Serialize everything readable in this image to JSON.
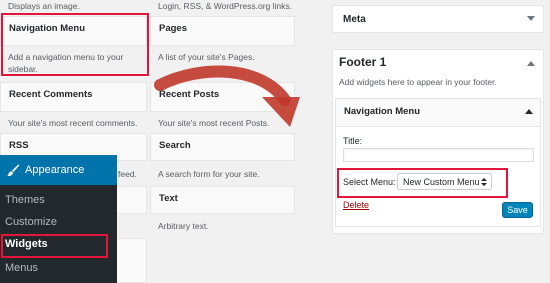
{
  "available_widgets": {
    "top_left_desc": "Displays an image.",
    "top_mid_desc": "Login, RSS, & WordPress.org links.",
    "navigation_menu": {
      "title": "Navigation Menu",
      "desc": "Add a navigation menu to your sidebar."
    },
    "pages": {
      "title": "Pages",
      "desc": "A list of your site's Pages."
    },
    "recent_comments": {
      "title": "Recent Comments",
      "desc": "Your site's most recent comments."
    },
    "recent_posts": {
      "title": "Recent Posts",
      "desc": "Your site's most recent Posts."
    },
    "rss": {
      "title": "RSS",
      "desc": "feed."
    },
    "search": {
      "title": "Search",
      "desc": "A search form for your site."
    },
    "text": {
      "title": "Text",
      "desc": "Arbitrary text."
    }
  },
  "admin_menu": {
    "appearance": "Appearance",
    "items": [
      "Themes",
      "Customize",
      "Widgets",
      "Menus"
    ]
  },
  "sidebars": {
    "meta_title": "Meta",
    "footer_title": "Footer 1",
    "footer_desc": "Add widgets here to appear in your footer.",
    "nav_widget": {
      "title": "Navigation Menu",
      "title_label": "Title:",
      "title_value": "",
      "select_label": "Select Menu:",
      "select_value": "New Custom Menu",
      "delete_label": "Delete",
      "save_label": "Save"
    }
  },
  "colors": {
    "highlight": "#e2163a",
    "admin_blue": "#0073aa",
    "menu_dark": "#23282d",
    "arrow": "#c0392b"
  }
}
